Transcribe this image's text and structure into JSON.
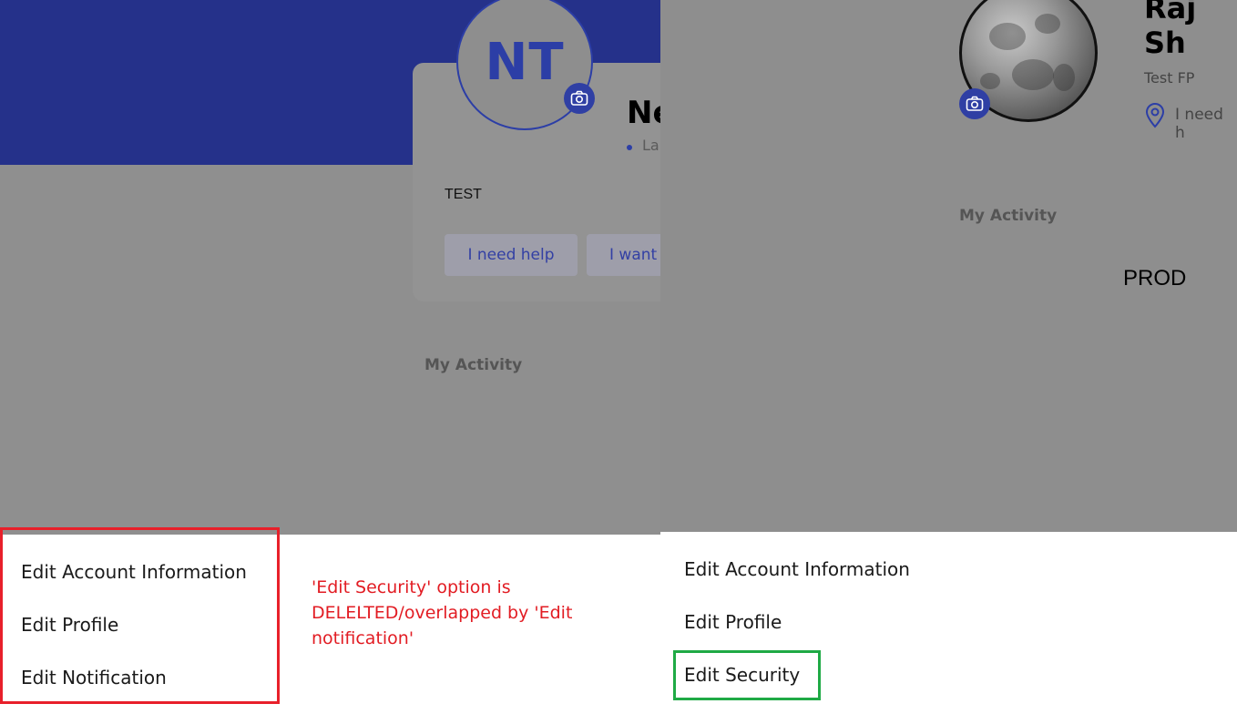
{
  "left": {
    "avatar_initials": "NT",
    "name_fragment": "Ne",
    "location_fragment": "La",
    "bio": "TEST",
    "chips": [
      "I need help",
      "I want"
    ],
    "activity_label": "My Activity",
    "menu": [
      "Edit Account Information",
      "Edit Profile",
      "Edit Notification"
    ]
  },
  "annotation": {
    "note": "'Edit Security' option is DELELTED/overlapped by 'Edit notification'"
  },
  "right": {
    "name_fragment": "Raj Sh",
    "subtitle": "Test FP",
    "location_fragment": "I need h",
    "activity_label": "My Activity",
    "env_label": "PROD",
    "menu": [
      "Edit Account Information",
      "Edit Profile",
      "Edit Security"
    ]
  },
  "colors": {
    "brand_blue": "#25318a",
    "accent_blue": "#2c3ea6",
    "annotation_red": "#e8202a",
    "annotation_green": "#1faa45"
  }
}
